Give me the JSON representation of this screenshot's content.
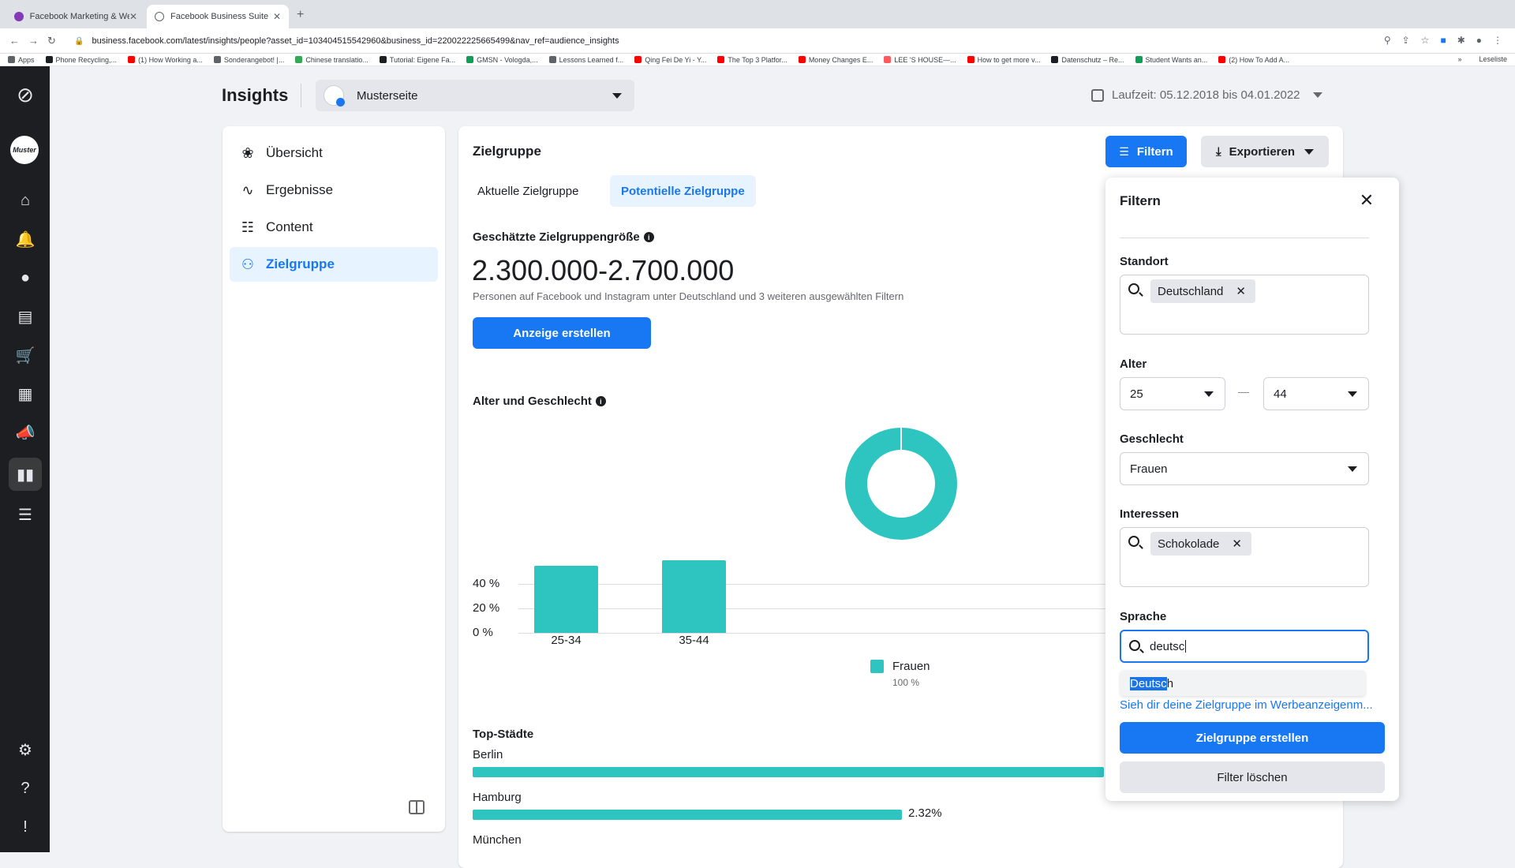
{
  "browser": {
    "tabs": [
      {
        "title": "Facebook Marketing & Werbea",
        "active": false
      },
      {
        "title": "Facebook Business Suite",
        "active": true
      }
    ],
    "url": "business.facebook.com/latest/insights/people?asset_id=103404515542960&business_id=220022225665499&nav_ref=audience_insights",
    "bookmarks": [
      {
        "label": "Apps",
        "color": "#5f6368"
      },
      {
        "label": "Phone Recycling,...",
        "color": "#1c1e21"
      },
      {
        "label": "(1) How Working a...",
        "color": "#ff0000"
      },
      {
        "label": "Sonderangebot! |...",
        "color": "#5f6368"
      },
      {
        "label": "Chinese translatio...",
        "color": "#34a853"
      },
      {
        "label": "Tutorial: Eigene Fa...",
        "color": "#1c1e21"
      },
      {
        "label": "GMSN - Vologda,...",
        "color": "#0f9d58"
      },
      {
        "label": "Lessons Learned f...",
        "color": "#5f6368"
      },
      {
        "label": "Qing Fei De Yi - Y...",
        "color": "#ff0000"
      },
      {
        "label": "The Top 3 Platfor...",
        "color": "#ff0000"
      },
      {
        "label": "Money Changes E...",
        "color": "#ff0000"
      },
      {
        "label": "LEE 'S HOUSE—...",
        "color": "#ff5a5f"
      },
      {
        "label": "How to get more v...",
        "color": "#ff0000"
      },
      {
        "label": "Datenschutz – Re...",
        "color": "#1c1e21"
      },
      {
        "label": "Student Wants an...",
        "color": "#0f9d58"
      },
      {
        "label": "(2) How To Add A...",
        "color": "#ff0000"
      }
    ],
    "reading_list": "Leseliste",
    "overflow": "»"
  },
  "header": {
    "title": "Insights",
    "page_name": "Musterseite",
    "date_range": "Laufzeit: 05.12.2018 bis 04.01.2022",
    "avatar_text": "Muster"
  },
  "nav": {
    "items": [
      {
        "label": "Übersicht",
        "icon": "overview-icon",
        "glyph": "❀",
        "selected": false
      },
      {
        "label": "Ergebnisse",
        "icon": "results-icon",
        "glyph": "∿",
        "selected": false
      },
      {
        "label": "Content",
        "icon": "content-icon",
        "glyph": "☷",
        "selected": false
      },
      {
        "label": "Zielgruppe",
        "icon": "audience-icon",
        "glyph": "⚇",
        "selected": true
      }
    ]
  },
  "main": {
    "title": "Zielgruppe",
    "filter_button": "Filtern",
    "export_button": "Exportieren",
    "tabs": [
      {
        "label": "Aktuelle Zielgruppe",
        "selected": false
      },
      {
        "label": "Potentielle Zielgruppe",
        "selected": true
      }
    ],
    "estimate_label": "Geschätzte Zielgruppengröße",
    "estimate_value": "2.300.000-2.700.000",
    "estimate_sub": "Personen auf Facebook und Instagram unter Deutschland und 3 weiteren ausgewählten Filtern",
    "create_ad_button": "Anzeige erstellen",
    "age_gender_label": "Alter und Geschlecht",
    "top_cities_label": "Top-Städte",
    "cities": [
      {
        "name": "Berlin",
        "pct_text": "",
        "fraction": 1.0
      },
      {
        "name": "Hamburg",
        "pct_text": "2.32%",
        "fraction": 0.68
      },
      {
        "name": "München",
        "pct_text": "",
        "fraction": 0
      }
    ]
  },
  "chart_data": {
    "type": "bar",
    "categories": [
      "25-34",
      "35-44"
    ],
    "series": [
      {
        "name": "Frauen",
        "values": [
          47,
          51
        ]
      }
    ],
    "yticks": [
      "40 %",
      "20 %",
      "0 %"
    ],
    "ylim": [
      0,
      60
    ],
    "legend": {
      "name": "Frauen",
      "pct": "100 %",
      "placement": "bottom"
    },
    "donut": {
      "Frauen": 100
    },
    "color": "#2ec4c0"
  },
  "filter_panel": {
    "title": "Filtern",
    "location_label": "Standort",
    "location_chip": "Deutschland",
    "age_label": "Alter",
    "age_min": "25",
    "age_max": "44",
    "gender_label": "Geschlecht",
    "gender_value": "Frauen",
    "interests_label": "Interessen",
    "interest_chip": "Schokolade",
    "language_label": "Sprache",
    "language_input": "deutsc",
    "suggestion_match": "Deutsc",
    "suggestion_rest": "h",
    "link_text": "Sieh dir deine Zielgruppe im Werbeanzeigenm...",
    "create_button": "Zielgruppe erstellen",
    "clear_button": "Filter löschen"
  },
  "colors": {
    "accent": "#1877f2",
    "chart": "#2ec4c0",
    "rail": "#1c1e21"
  }
}
